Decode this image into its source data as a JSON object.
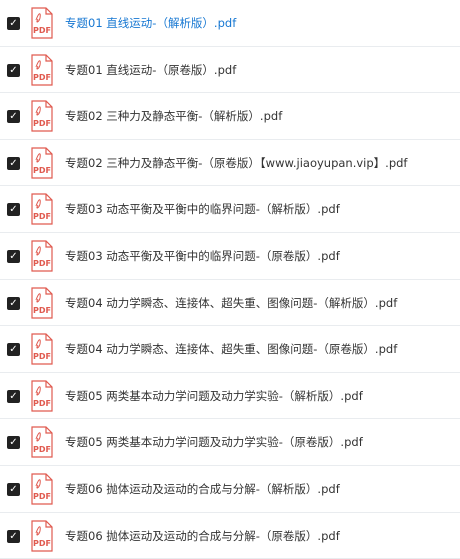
{
  "files": [
    {
      "name": "专题01 直线运动-（解析版）.pdf",
      "checked": true,
      "active": true
    },
    {
      "name": "专题01 直线运动-（原卷版）.pdf",
      "checked": true,
      "active": false
    },
    {
      "name": "专题02 三种力及静态平衡-（解析版）.pdf",
      "checked": true,
      "active": false
    },
    {
      "name": "专题02 三种力及静态平衡-（原卷版）【www.jiaoyupan.vip】.pdf",
      "checked": true,
      "active": false
    },
    {
      "name": "专题03 动态平衡及平衡中的临界问题-（解析版）.pdf",
      "checked": true,
      "active": false
    },
    {
      "name": "专题03 动态平衡及平衡中的临界问题-（原卷版）.pdf",
      "checked": true,
      "active": false
    },
    {
      "name": "专题04 动力学瞬态、连接体、超失重、图像问题-（解析版）.pdf",
      "checked": true,
      "active": false
    },
    {
      "name": "专题04 动力学瞬态、连接体、超失重、图像问题-（原卷版）.pdf",
      "checked": true,
      "active": false
    },
    {
      "name": "专题05 两类基本动力学问题及动力学实验-（解析版）.pdf",
      "checked": true,
      "active": false
    },
    {
      "name": "专题05 两类基本动力学问题及动力学实验-（原卷版）.pdf",
      "checked": true,
      "active": false
    },
    {
      "name": "专题06 抛体运动及运动的合成与分解-（解析版）.pdf",
      "checked": true,
      "active": false
    },
    {
      "name": "专题06 抛体运动及运动的合成与分解-（原卷版）.pdf",
      "checked": true,
      "active": false
    }
  ],
  "icon": {
    "name": "pdf-file-icon",
    "label": "PDF",
    "color": "#e05a4f"
  },
  "checkbox_glyph": "✓",
  "colors": {
    "active_text": "#1677d2",
    "text": "#333333",
    "divider": "#e9ecef"
  }
}
